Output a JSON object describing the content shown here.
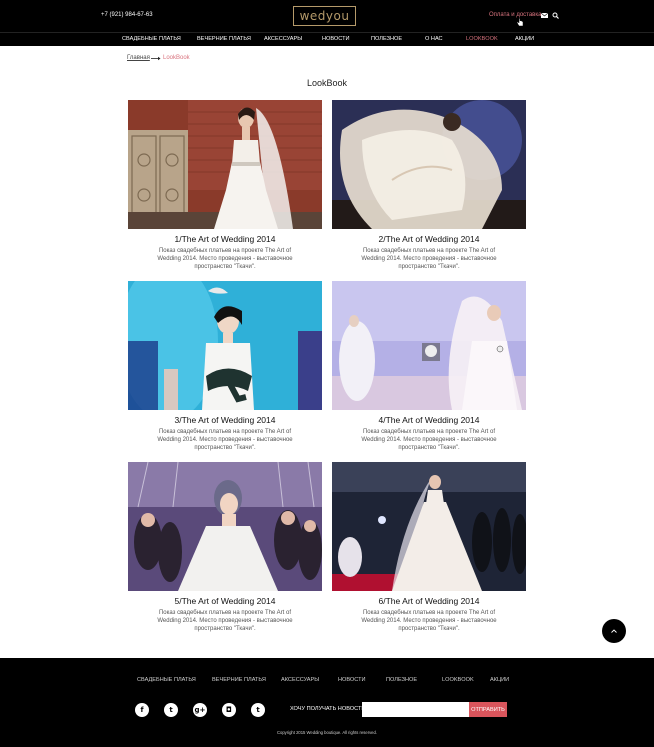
{
  "header": {
    "phone": "+7 (921) 984-67-63",
    "logo": "wedyou",
    "pay_link": "Оплата и доставка"
  },
  "nav": {
    "items": [
      {
        "label": "СВАДЕБНЫЕ ПЛАТЬЯ"
      },
      {
        "label": "ВЕЧЕРНИЕ ПЛАТЬЯ"
      },
      {
        "label": "АКСЕССУАРЫ"
      },
      {
        "label": "НОВОСТИ"
      },
      {
        "label": "ПОЛЕЗНОЕ"
      },
      {
        "label": "О НАС"
      },
      {
        "label": "LOOKBOOK",
        "active": true
      },
      {
        "label": "АКЦИИ"
      }
    ]
  },
  "breadcrumb": {
    "home": "Главная",
    "current": "LookBook"
  },
  "page_title": "LookBook",
  "cards": [
    {
      "title": "1/The Art of Wedding 2014",
      "desc": "Показ свадебных платьев на проекте The Art of Wedding 2014. Место проведения - выставочное пространство \"Ткачи\"."
    },
    {
      "title": "2/The Art of Wedding 2014",
      "desc": "Показ свадебных платьев на проекте The Art of Wedding 2014. Место проведения - выставочное пространство \"Ткачи\"."
    },
    {
      "title": "3/The Art of Wedding 2014",
      "desc": "Показ свадебных платьев на проекте The Art of Wedding 2014. Место проведения - выставочное пространство \"Ткачи\"."
    },
    {
      "title": "4/The Art of Wedding 2014",
      "desc": "Показ свадебных платьев на проекте The Art of Wedding 2014. Место проведения - выставочное пространство \"Ткачи\"."
    },
    {
      "title": "5/The Art of Wedding 2014",
      "desc": "Показ свадебных платьев на проекте The Art of Wedding 2014. Место проведения - выставочное пространство \"Ткачи\"."
    },
    {
      "title": "6/The Art of Wedding 2014",
      "desc": "Показ свадебных платьев на проекте The Art of Wedding 2014. Место проведения - выставочное пространство \"Ткачи\"."
    }
  ],
  "footer": {
    "nav": [
      "СВАДЕБНЫЕ ПЛАТЬЯ",
      "ВЕЧЕРНИЕ ПЛАТЬЯ",
      "АКСЕССУАРЫ",
      "НОВОСТИ",
      "ПОЛЕЗНОЕ",
      "LOOKBOOK",
      "АКЦИИ"
    ],
    "social": [
      {
        "icon": "facebook-icon",
        "glyph": "f"
      },
      {
        "icon": "twitter-icon",
        "glyph": "t"
      },
      {
        "icon": "googleplus-icon",
        "glyph": "g+"
      },
      {
        "icon": "instagram-icon",
        "glyph": "◘"
      },
      {
        "icon": "tumblr-icon",
        "glyph": "t"
      }
    ],
    "subscribe_label": "ХОЧУ ПОЛУЧАТЬ НОВОСТИ",
    "subscribe_value": "",
    "subscribe_button": "ОТПРАВИТЬ",
    "copyright": "Copyright 2015 Wedding boutique. All rights reserved."
  },
  "colors": {
    "accent": "#d9747f",
    "logo_gold": "#b59a6a",
    "button": "#d9555c",
    "bg_dark": "#000000"
  }
}
